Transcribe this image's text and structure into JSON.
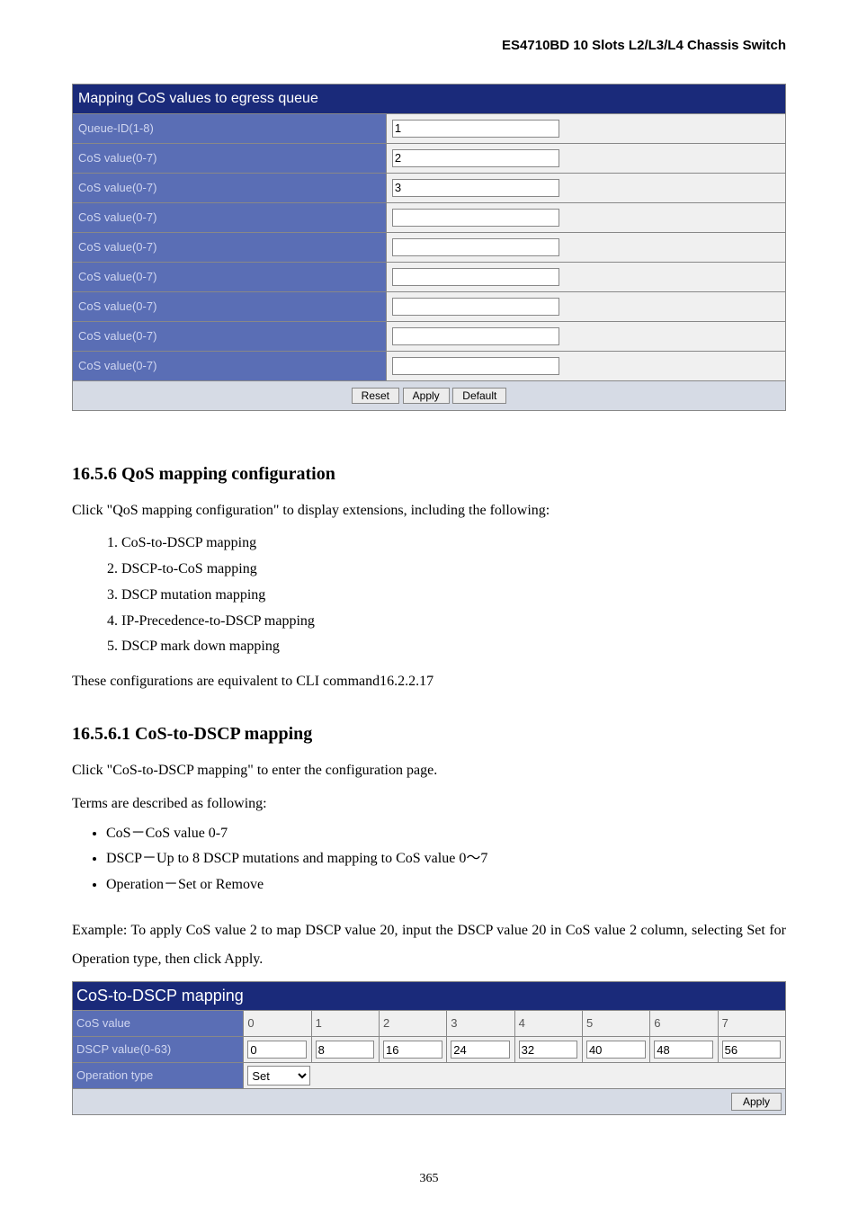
{
  "header": {
    "title": "ES4710BD 10 Slots L2/L3/L4 Chassis Switch"
  },
  "table1": {
    "title": "Mapping CoS values to egress queue",
    "rows": [
      {
        "label": "Queue-ID(1-8)",
        "value": "1"
      },
      {
        "label": "CoS value(0-7)",
        "value": "2"
      },
      {
        "label": "CoS value(0-7)",
        "value": "3"
      },
      {
        "label": "CoS value(0-7)",
        "value": ""
      },
      {
        "label": "CoS value(0-7)",
        "value": ""
      },
      {
        "label": "CoS value(0-7)",
        "value": ""
      },
      {
        "label": "CoS value(0-7)",
        "value": ""
      },
      {
        "label": "CoS value(0-7)",
        "value": ""
      },
      {
        "label": "CoS value(0-7)",
        "value": ""
      }
    ],
    "buttons": {
      "reset": "Reset",
      "apply": "Apply",
      "default": "Default"
    }
  },
  "section": {
    "num": "16.5.6",
    "title": "QoS mapping configuration",
    "intro": "Click \"QoS mapping configuration\" to display extensions, including the following:",
    "items": [
      "CoS-to-DSCP mapping",
      "DSCP-to-CoS mapping",
      "DSCP mutation mapping",
      "IP-Precedence-to-DSCP mapping",
      "DSCP mark down mapping"
    ],
    "note": "These configurations are equivalent to CLI command16.2.2.17"
  },
  "subsection": {
    "num": "16.5.6.1",
    "title": "CoS-to-DSCP mapping",
    "p1": "Click \"CoS-to-DSCP mapping\" to enter the configuration page.",
    "p2": "Terms are described as following:",
    "bullets": [
      "CoS－CoS value 0-7",
      "DSCP－Up to 8 DSCP mutations and mapping to CoS value 0～7",
      "Operation－Set or Remove"
    ],
    "example": "Example: To apply CoS value 2 to map DSCP value 20, input the DSCP value 20 in CoS value 2 column, selecting Set for Operation type, then click Apply."
  },
  "table2": {
    "title": "CoS-to-DSCP mapping",
    "row_cos_label": "CoS value",
    "cos_values": [
      "0",
      "1",
      "2",
      "3",
      "4",
      "5",
      "6",
      "7"
    ],
    "row_dscp_label": "DSCP value(0-63)",
    "dscp_values": [
      "0",
      "8",
      "16",
      "24",
      "32",
      "40",
      "48",
      "56"
    ],
    "row_op_label": "Operation type",
    "op_selected": "Set",
    "apply": "Apply"
  },
  "page_number": "365"
}
